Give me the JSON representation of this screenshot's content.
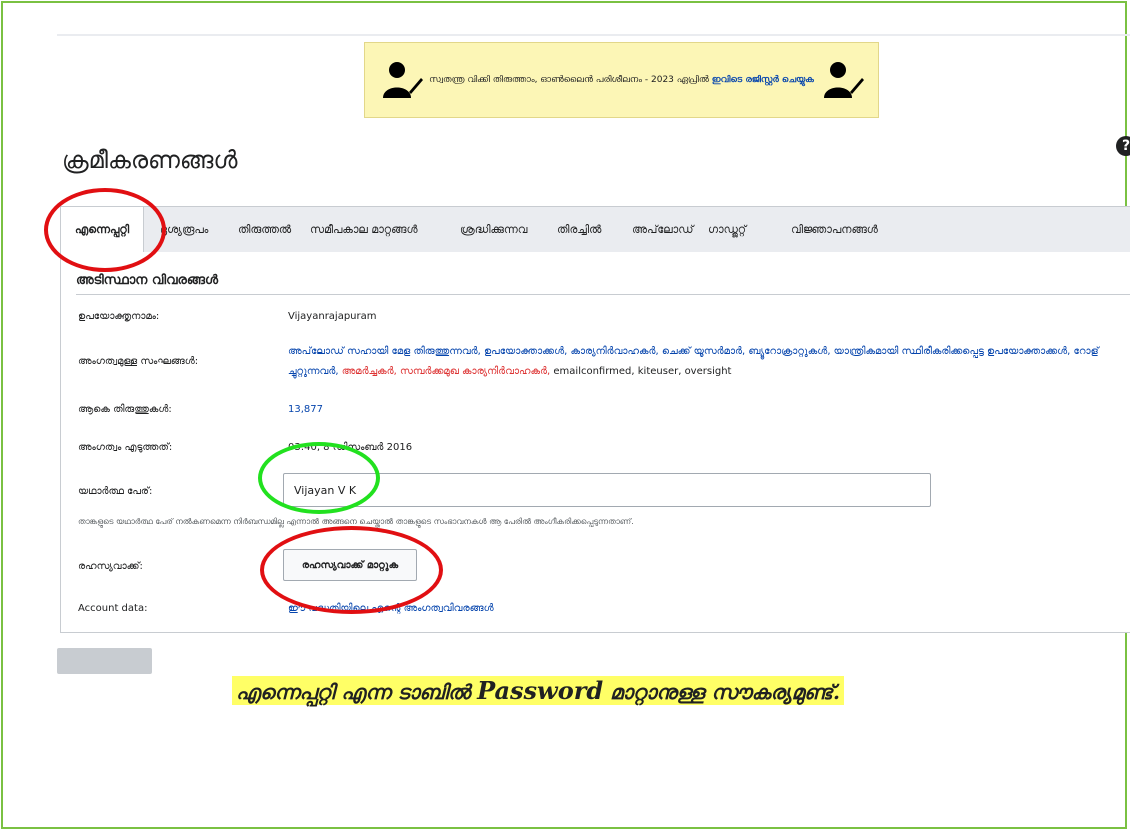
{
  "banner": {
    "text": "സ്വതന്ത്ര വിക്കി തിരുത്താം, ഓൺലൈൻ പരിശീലനം - 2023 ഏപ്രിൽ",
    "link": "ഇവിടെ രജിസ്റ്റർ ചെയ്യുക"
  },
  "page": {
    "title": "ക്രമീകരണങ്ങൾ",
    "help": "?"
  },
  "tabs": [
    {
      "label": "എന്നെപ്പറ്റി"
    },
    {
      "label": "ദൃശ്യരൂപം"
    },
    {
      "label": "തിരുത്തൽ"
    },
    {
      "label": "സമീപകാല മാറ്റങ്ങൾ"
    },
    {
      "label": "ശ്രദ്ധിക്കുന്നവ"
    },
    {
      "label": "തിരച്ചിൽ"
    },
    {
      "label": "അപ്‌ലോഡ്"
    },
    {
      "label": "ഗാഡ്ജറ്റ്"
    },
    {
      "label": "വിജ്ഞാപനങ്ങൾ"
    }
  ],
  "section": {
    "heading": "അടിസ്ഥാന വിവരങ്ങൾ"
  },
  "fields": {
    "username_label": "ഉപയോക്തൃനാമം:",
    "username_value": "Vijayanrajapuram",
    "groups_label": "അംഗത്വമുള്ള സംഘങ്ങൾ:",
    "groups_line1": "അപ്‌ലോഡ് സഹായി മേള തിരുത്തുന്നവർ, ഉപയോക്താക്കൾ, കാര്യനിർവാഹകർ, ചെക്ക് യൂസർമാർ, ബ്യൂറോക്രാറ്റുകൾ, യാന്ത്രികമായി സ്ഥിരീകരിക്കപ്പെട്ട ഉപയോക്താക്കൾ, റോള്",
    "groups_line2_a": "ച്ചുറ്റുന്നവർ,",
    "groups_line2_b": "അമർച്ചകർ, സമ്പർക്കമുഖ കാര്യനിർവാഹകർ,",
    "groups_line2_c": "emailconfirmed, kiteuser, oversight",
    "edits_label": "ആകെ തിരുത്തുകൾ:",
    "edits_value": "13,877",
    "joined_label": "അംഗത്വം എടുത്തത്:",
    "joined_value": "03:40, 8 ഡിസംബർ 2016",
    "realname_label": "യഥാർത്ഥ പേര്:",
    "realname_value": "Vijayan V K",
    "realname_help": "താങ്കളുടെ യഥാർത്ഥ പേര് നൽകണമെന്ന നിർബന്ധമില്ല എന്നാൽ അങ്ങനെ ചെയ്താൽ താങ്കളുടെ സംഭാവനകൾ ആ പേരിൽ അംഗീകരിക്കപ്പെടുന്നതാണ്.",
    "password_label": "രഹസ്യവാക്ക്:",
    "password_button": "രഹസ്യവാക്ക് മാറ്റുക",
    "account_label": "Account data:",
    "account_link": "ഈ പദ്ധതിയിലെ എന്റെ അംഗത്വവിവരങ്ങൾ"
  },
  "caption": {
    "part1": "എന്നെപ്പറ്റി എന്ന ടാബിൽ",
    "part2": "Password",
    "part3": "മാറ്റാനുള്ള സൗകര്യമുണ്ട്."
  },
  "annotation_colors": {
    "red": "#e10f12",
    "green": "#22e11f",
    "caption_highlight": "#ffff66"
  }
}
